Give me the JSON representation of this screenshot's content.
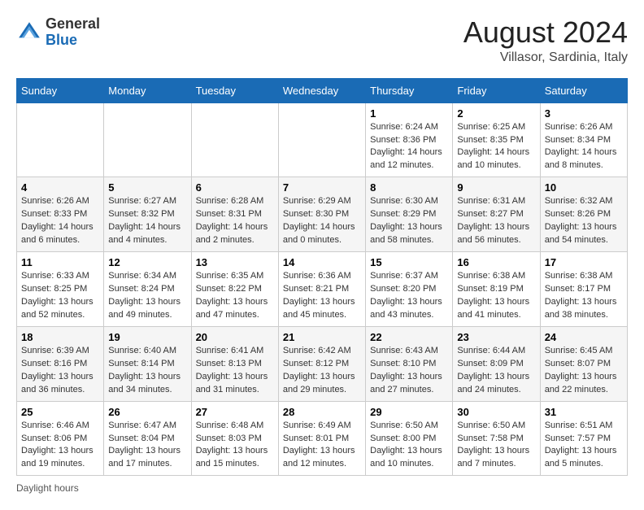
{
  "header": {
    "logo_general": "General",
    "logo_blue": "Blue",
    "month_year": "August 2024",
    "location": "Villasor, Sardinia, Italy"
  },
  "days_of_week": [
    "Sunday",
    "Monday",
    "Tuesday",
    "Wednesday",
    "Thursday",
    "Friday",
    "Saturday"
  ],
  "weeks": [
    [
      {
        "day": "",
        "info": ""
      },
      {
        "day": "",
        "info": ""
      },
      {
        "day": "",
        "info": ""
      },
      {
        "day": "",
        "info": ""
      },
      {
        "day": "1",
        "info": "Sunrise: 6:24 AM\nSunset: 8:36 PM\nDaylight: 14 hours and 12 minutes."
      },
      {
        "day": "2",
        "info": "Sunrise: 6:25 AM\nSunset: 8:35 PM\nDaylight: 14 hours and 10 minutes."
      },
      {
        "day": "3",
        "info": "Sunrise: 6:26 AM\nSunset: 8:34 PM\nDaylight: 14 hours and 8 minutes."
      }
    ],
    [
      {
        "day": "4",
        "info": "Sunrise: 6:26 AM\nSunset: 8:33 PM\nDaylight: 14 hours and 6 minutes."
      },
      {
        "day": "5",
        "info": "Sunrise: 6:27 AM\nSunset: 8:32 PM\nDaylight: 14 hours and 4 minutes."
      },
      {
        "day": "6",
        "info": "Sunrise: 6:28 AM\nSunset: 8:31 PM\nDaylight: 14 hours and 2 minutes."
      },
      {
        "day": "7",
        "info": "Sunrise: 6:29 AM\nSunset: 8:30 PM\nDaylight: 14 hours and 0 minutes."
      },
      {
        "day": "8",
        "info": "Sunrise: 6:30 AM\nSunset: 8:29 PM\nDaylight: 13 hours and 58 minutes."
      },
      {
        "day": "9",
        "info": "Sunrise: 6:31 AM\nSunset: 8:27 PM\nDaylight: 13 hours and 56 minutes."
      },
      {
        "day": "10",
        "info": "Sunrise: 6:32 AM\nSunset: 8:26 PM\nDaylight: 13 hours and 54 minutes."
      }
    ],
    [
      {
        "day": "11",
        "info": "Sunrise: 6:33 AM\nSunset: 8:25 PM\nDaylight: 13 hours and 52 minutes."
      },
      {
        "day": "12",
        "info": "Sunrise: 6:34 AM\nSunset: 8:24 PM\nDaylight: 13 hours and 49 minutes."
      },
      {
        "day": "13",
        "info": "Sunrise: 6:35 AM\nSunset: 8:22 PM\nDaylight: 13 hours and 47 minutes."
      },
      {
        "day": "14",
        "info": "Sunrise: 6:36 AM\nSunset: 8:21 PM\nDaylight: 13 hours and 45 minutes."
      },
      {
        "day": "15",
        "info": "Sunrise: 6:37 AM\nSunset: 8:20 PM\nDaylight: 13 hours and 43 minutes."
      },
      {
        "day": "16",
        "info": "Sunrise: 6:38 AM\nSunset: 8:19 PM\nDaylight: 13 hours and 41 minutes."
      },
      {
        "day": "17",
        "info": "Sunrise: 6:38 AM\nSunset: 8:17 PM\nDaylight: 13 hours and 38 minutes."
      }
    ],
    [
      {
        "day": "18",
        "info": "Sunrise: 6:39 AM\nSunset: 8:16 PM\nDaylight: 13 hours and 36 minutes."
      },
      {
        "day": "19",
        "info": "Sunrise: 6:40 AM\nSunset: 8:14 PM\nDaylight: 13 hours and 34 minutes."
      },
      {
        "day": "20",
        "info": "Sunrise: 6:41 AM\nSunset: 8:13 PM\nDaylight: 13 hours and 31 minutes."
      },
      {
        "day": "21",
        "info": "Sunrise: 6:42 AM\nSunset: 8:12 PM\nDaylight: 13 hours and 29 minutes."
      },
      {
        "day": "22",
        "info": "Sunrise: 6:43 AM\nSunset: 8:10 PM\nDaylight: 13 hours and 27 minutes."
      },
      {
        "day": "23",
        "info": "Sunrise: 6:44 AM\nSunset: 8:09 PM\nDaylight: 13 hours and 24 minutes."
      },
      {
        "day": "24",
        "info": "Sunrise: 6:45 AM\nSunset: 8:07 PM\nDaylight: 13 hours and 22 minutes."
      }
    ],
    [
      {
        "day": "25",
        "info": "Sunrise: 6:46 AM\nSunset: 8:06 PM\nDaylight: 13 hours and 19 minutes."
      },
      {
        "day": "26",
        "info": "Sunrise: 6:47 AM\nSunset: 8:04 PM\nDaylight: 13 hours and 17 minutes."
      },
      {
        "day": "27",
        "info": "Sunrise: 6:48 AM\nSunset: 8:03 PM\nDaylight: 13 hours and 15 minutes."
      },
      {
        "day": "28",
        "info": "Sunrise: 6:49 AM\nSunset: 8:01 PM\nDaylight: 13 hours and 12 minutes."
      },
      {
        "day": "29",
        "info": "Sunrise: 6:50 AM\nSunset: 8:00 PM\nDaylight: 13 hours and 10 minutes."
      },
      {
        "day": "30",
        "info": "Sunrise: 6:50 AM\nSunset: 7:58 PM\nDaylight: 13 hours and 7 minutes."
      },
      {
        "day": "31",
        "info": "Sunrise: 6:51 AM\nSunset: 7:57 PM\nDaylight: 13 hours and 5 minutes."
      }
    ]
  ],
  "footer": {
    "daylight_label": "Daylight hours"
  }
}
